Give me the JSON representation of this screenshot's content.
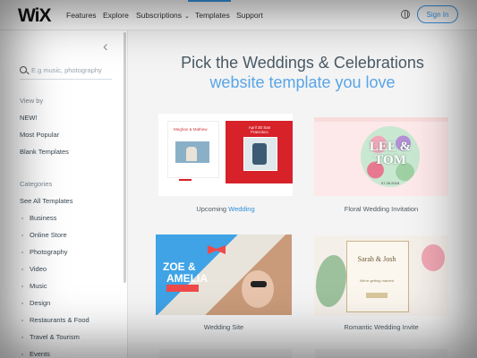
{
  "header": {
    "logo": "WiX",
    "links": [
      "Features",
      "Explore",
      "Subscriptions",
      "Templates",
      "Support"
    ],
    "subscriptions_chevron": "chevron-down-icon",
    "active_link": "Templates",
    "globe_icon": "globe-icon",
    "sign_in": "Sign In",
    "accent": "#3899ec"
  },
  "sidebar": {
    "collapse_icon": "chevron-left-icon",
    "search_placeholder": "E.g music, photography",
    "view_by_label": "View by",
    "view_by_items": [
      "NEW!",
      "Most Popular",
      "Blank Templates"
    ],
    "categories_label": "Categories",
    "see_all": "See All Templates",
    "categories": [
      "Business",
      "Online Store",
      "Photography",
      "Video",
      "Music",
      "Design",
      "Restaurants & Food",
      "Travel & Tourism",
      "Events"
    ]
  },
  "main": {
    "title_line1": "Pick the Weddings & Celebrations",
    "title_line2": "website template you love",
    "templates": [
      {
        "caption_prefix": "Upcoming",
        "caption_highlight": " Wedding",
        "inner_left": "Meghan & Mathew",
        "inner_right": "April 30 San Francisco"
      },
      {
        "caption": "Floral Wedding Invitation",
        "inner_text": "LEE & TOM",
        "inner_date": "07.28.2018"
      },
      {
        "caption": "Wedding Site",
        "inner_text_1": "ZOE &",
        "inner_text_2": "AMELIA"
      },
      {
        "caption": "Romantic Wedding Invite",
        "inner_text": "Sarah & Josh",
        "inner_sub": "We're getting married"
      }
    ]
  }
}
